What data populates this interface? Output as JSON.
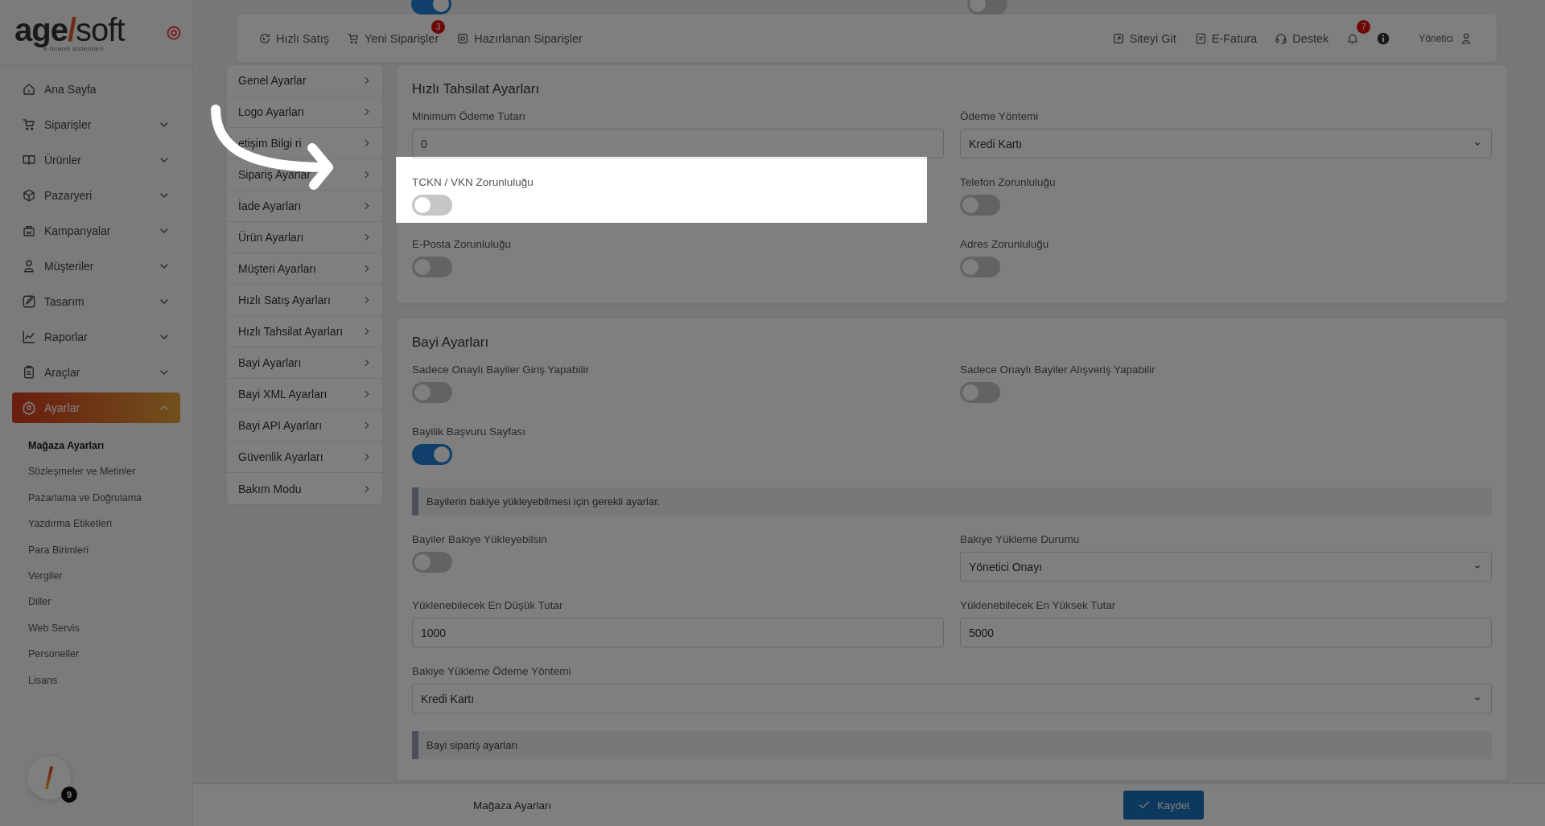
{
  "sidebar": {
    "logo": {
      "part1": "age",
      "slash": "/",
      "part2": "soft",
      "tagline": "e-ticaret sistemleri"
    },
    "items": [
      {
        "label": "Ana Sayfa",
        "kind": "link",
        "selected": false
      },
      {
        "label": "Siparişler",
        "kind": "group",
        "selected": false,
        "expanded": false
      },
      {
        "label": "Ürünler",
        "kind": "group",
        "selected": false,
        "expanded": false
      },
      {
        "label": "Pazaryeri",
        "kind": "group",
        "selected": false,
        "expanded": false
      },
      {
        "label": "Kampanyalar",
        "kind": "group",
        "selected": false,
        "expanded": false
      },
      {
        "label": "Müşteriler",
        "kind": "group",
        "selected": false,
        "expanded": false
      },
      {
        "label": "Tasarım",
        "kind": "group",
        "selected": false,
        "expanded": false
      },
      {
        "label": "Raporlar",
        "kind": "group",
        "selected": false,
        "expanded": false
      },
      {
        "label": "Araçlar",
        "kind": "group",
        "selected": false,
        "expanded": false
      },
      {
        "label": "Ayarlar",
        "kind": "group",
        "selected": true,
        "expanded": true,
        "children": [
          {
            "label": "Mağaza Ayarları",
            "selected": true
          },
          {
            "label": "Sözleşmeler ve Metinler",
            "selected": false
          },
          {
            "label": "Pazarlama ve Doğrulama",
            "selected": false
          },
          {
            "label": "Yazdırma Etiketleri",
            "selected": false
          },
          {
            "label": "Para Birimleri",
            "selected": false
          },
          {
            "label": "Vergiler",
            "selected": false
          },
          {
            "label": "Diller",
            "selected": false
          },
          {
            "label": "Web Servis",
            "selected": false
          },
          {
            "label": "Personeller",
            "selected": false
          },
          {
            "label": "Lisans",
            "selected": false
          }
        ]
      }
    ],
    "widget": {
      "badge": "9"
    }
  },
  "scrolled_toggles": [
    {
      "on": true
    },
    {
      "on": false
    }
  ],
  "top_bar": {
    "left": [
      {
        "label": "Hızlı Satış"
      },
      {
        "label": "Yeni Siparişler",
        "badge": "3"
      },
      {
        "label": "Hazırlanan Siparişler"
      }
    ],
    "right": [
      {
        "label": "Siteyi Git"
      },
      {
        "label": "E-Fatura"
      },
      {
        "label": "Destek"
      }
    ],
    "notifications_badge": "7",
    "user": "Yönetici"
  },
  "settings_menu": [
    "Genel Ayarlar",
    "Logo Ayarları",
    "etişim Bilgi ri",
    "Sipariş Ayarlar",
    "İade Ayarları",
    "Ürün Ayarları",
    "Müşteri Ayarları",
    "Hızlı Satış Ayarları",
    "Hızlı Tahsilat Ayarları",
    "Bayi Ayarları",
    "Bayi XML Ayarları",
    "Bayi API Ayarları",
    "Güvenlik Ayarları",
    "Bakım Modu"
  ],
  "cards": [
    {
      "title": "Hızlı Tahsilat Ayarları",
      "fields": [
        {
          "kind": "input",
          "label": "Minimum Ödeme Tutarı",
          "value": "0",
          "highlighted": false
        },
        {
          "kind": "select",
          "label": "Ödeme Yöntemi",
          "value": "Kredi Kartı",
          "highlighted": false
        },
        {
          "kind": "toggle",
          "label": "TCKN / VKN Zorunluluğu",
          "on": false,
          "highlighted": true
        },
        {
          "kind": "toggle",
          "label": "Telefon Zorunluluğu",
          "on": false,
          "highlighted": false
        },
        {
          "kind": "toggle",
          "label": "E-Posta Zorunluluğu",
          "on": false,
          "highlighted": false
        },
        {
          "kind": "toggle",
          "label": "Adres Zorunluluğu",
          "on": false,
          "highlighted": false
        }
      ]
    },
    {
      "title": "Bayi Ayarları",
      "fields": [
        {
          "kind": "toggle",
          "label": "Sadece Onaylı Bayiler Giriş Yapabilir",
          "on": false,
          "highlighted": false
        },
        {
          "kind": "toggle",
          "label": "Sadece Onaylı Bayiler Alışveriş Yapabilir",
          "on": false,
          "highlighted": false
        },
        {
          "kind": "toggle",
          "label": "Bayilik Başvuru Sayfası",
          "on": true,
          "highlighted": false
        },
        {
          "kind": "note",
          "text": "Bayilerin bakiye yükleyebilmesi için gerekli ayarlar.",
          "highlighted": false
        },
        {
          "kind": "toggle",
          "label": "Bayiler Bakiye Yükleyebilsin",
          "on": false,
          "highlighted": false
        },
        {
          "kind": "select",
          "label": "Bakiye Yükleme Durumu",
          "value": "Yönetici Onayı",
          "highlighted": false
        },
        {
          "kind": "input",
          "label": "Yüklenebilecek En Düşük Tutar",
          "value": "1000",
          "highlighted": false
        },
        {
          "kind": "input",
          "label": "Yüklenebilecek En Yüksek Tutar",
          "value": "5000",
          "highlighted": false
        },
        {
          "kind": "select",
          "label": "Bakiye Yükleme Ödeme Yöntemi",
          "value": "Kredi Kartı",
          "wide": true,
          "highlighted": false
        },
        {
          "kind": "note",
          "text": "Bayi sipariş ayarları",
          "highlighted": false
        }
      ]
    }
  ],
  "bottom_bar": {
    "title": "Mağaza Ayarları",
    "save_button": "Kaydet"
  }
}
